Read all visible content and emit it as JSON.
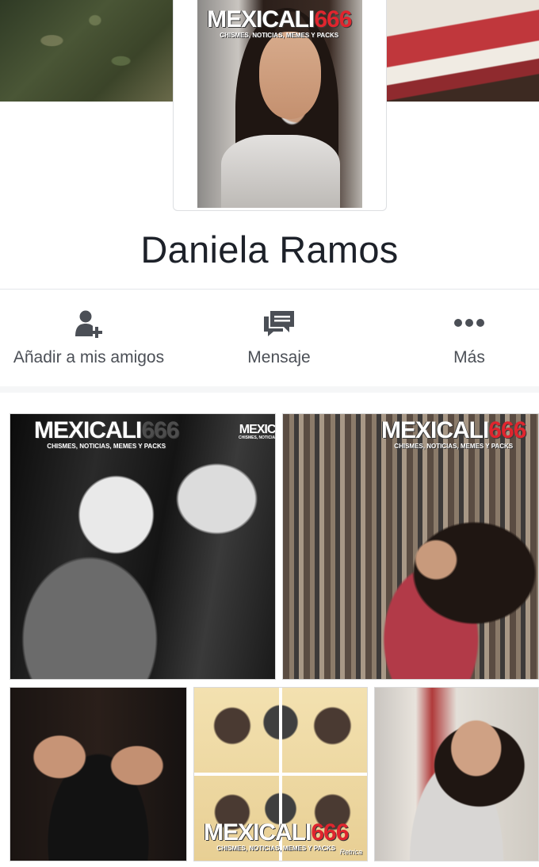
{
  "profile": {
    "name": "Daniela Ramos",
    "watermark": {
      "brand": "MEXICALI",
      "number": "666",
      "tagline": "CHISMES, NOTICIAS, MEMES Y PACKS"
    }
  },
  "actions": [
    {
      "label": "Añadir a mis amigos",
      "icon": "add-friend-icon"
    },
    {
      "label": "Mensaje",
      "icon": "message-icon"
    },
    {
      "label": "Más",
      "icon": "more-icon"
    }
  ],
  "photos": {
    "retrica_label": "Retrica"
  },
  "colors": {
    "icon_gray": "#4b4f56",
    "brand_red": "#e0252e",
    "divider": "#e4e6eb"
  }
}
